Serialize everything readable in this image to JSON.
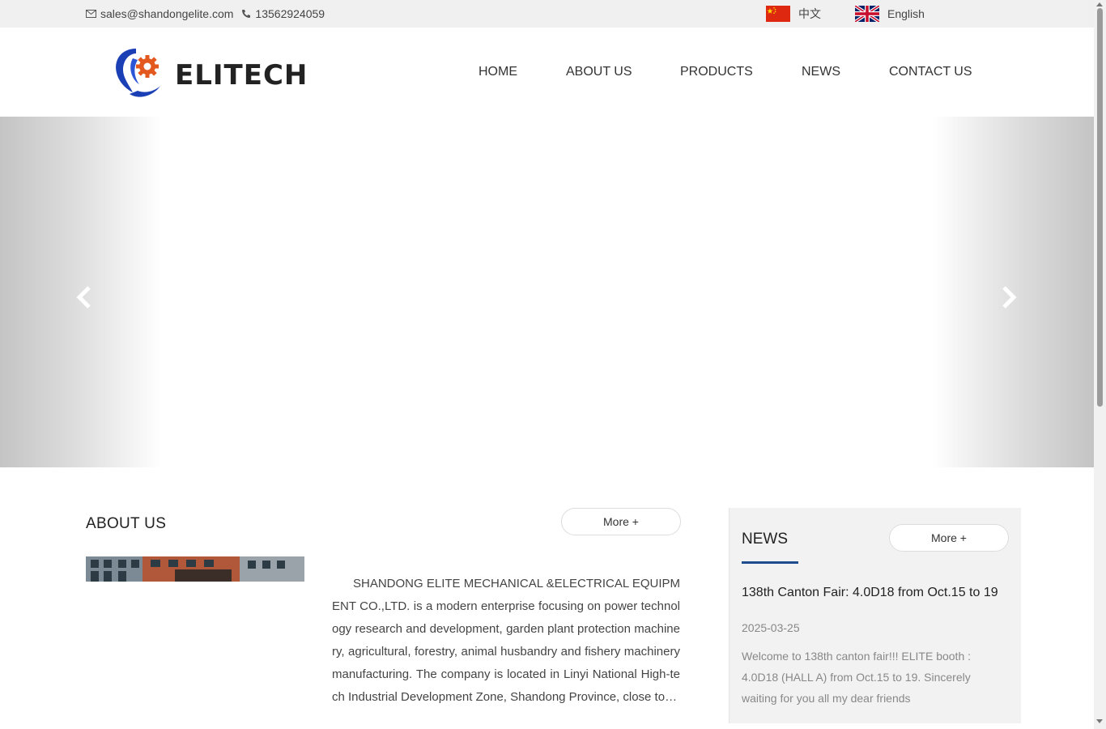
{
  "topbar": {
    "email": "sales@shandongelite.com",
    "phone": "13562924059",
    "lang_cn": "中文",
    "lang_en": "English"
  },
  "brand": {
    "logo_text": "ELITECH"
  },
  "nav": [
    "HOME",
    "ABOUT US",
    "PRODUCTS",
    "NEWS",
    "CONTACT US"
  ],
  "about": {
    "title": "ABOUT US",
    "more": "More +",
    "text": "SHANDONG ELITE MECHANICAL &ELECTRICAL EQUIPMENT CO.,LTD. is a modern enterprise focusing on power technology research and development, garden plant protection machinery, agricultural, forestry, animal husbandry and fishery machinery manufacturing. The company is located in Linyi National High-tech Industrial Development Zone, Shandong Province, close to…"
  },
  "news": {
    "title": "NEWS",
    "more": "More +",
    "headline": "138th Canton Fair: 4.0D18 from Oct.15 to 19",
    "date": "2025-03-25",
    "summary": "Welcome to 138th canton fair!!! ELITE booth : 4.0D18 (HALL A) from Oct.15 to 19. Sincerely waiting for you all my dear friends"
  },
  "colors": {
    "accent": "#1d4d8e",
    "logo_blue": "#1b3fb5",
    "logo_orange": "#e2581e",
    "topbar_bg": "#f0f0f0"
  },
  "icons": {
    "email": "envelope-icon",
    "phone": "phone-icon",
    "prev": "chevron-left-icon",
    "next": "chevron-right-icon"
  }
}
